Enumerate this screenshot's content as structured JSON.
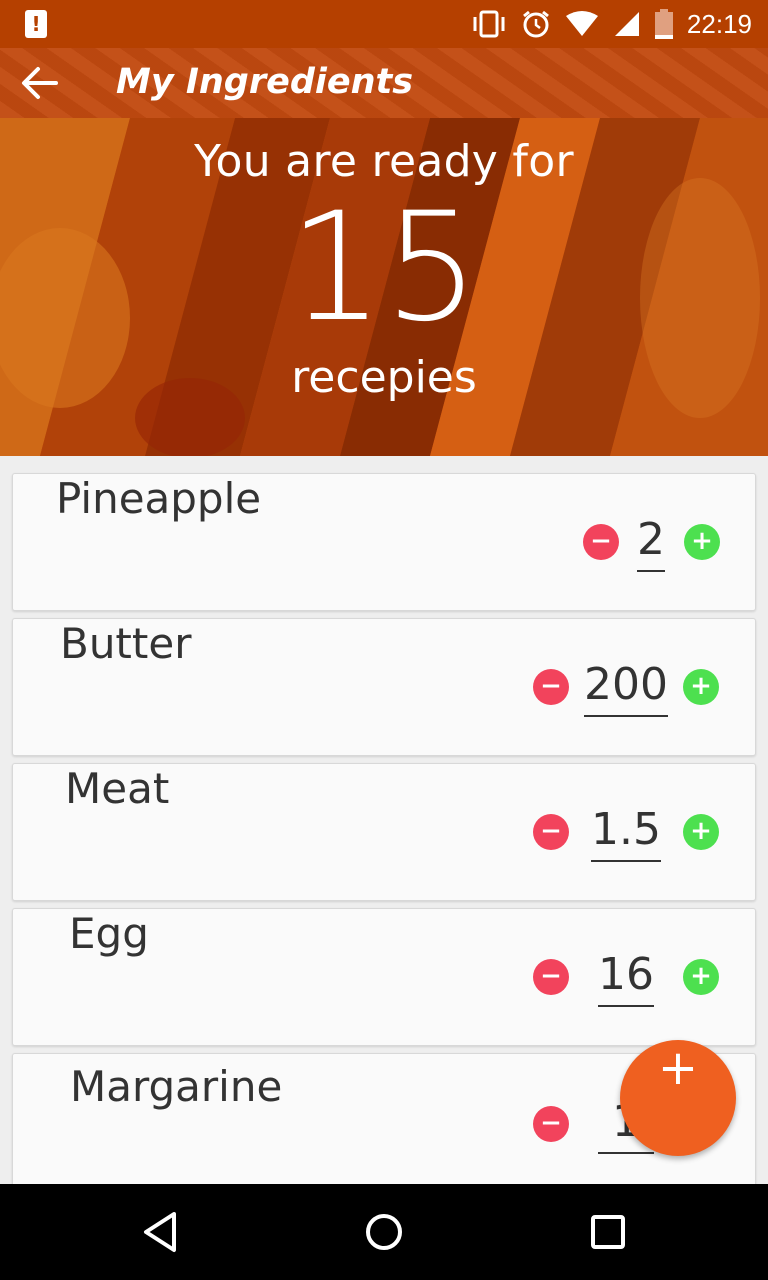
{
  "status_bar": {
    "time": "22:19",
    "icons": [
      "alert-icon",
      "vibrate-icon",
      "alarm-icon",
      "wifi-icon",
      "signal-icon",
      "battery-icon"
    ]
  },
  "app_bar": {
    "title": "My Ingredients",
    "back_icon": "arrow-left-icon"
  },
  "hero": {
    "line1": "You are ready for",
    "count": "15",
    "line3": "recepies"
  },
  "ingredients": [
    {
      "name": "Pineapple",
      "quantity": "2"
    },
    {
      "name": "Butter",
      "quantity": "200"
    },
    {
      "name": "Meat",
      "quantity": "1.5"
    },
    {
      "name": "Egg",
      "quantity": "16"
    },
    {
      "name": "Margarine",
      "quantity": "1"
    }
  ],
  "controls": {
    "minus_symbol": "−",
    "plus_symbol": "+",
    "fab_symbol": "+"
  },
  "colors": {
    "primary_dark": "#b54000",
    "primary": "#c24a10",
    "accent": "#ef6020",
    "minus": "#f2435c",
    "plus": "#4de04f"
  }
}
